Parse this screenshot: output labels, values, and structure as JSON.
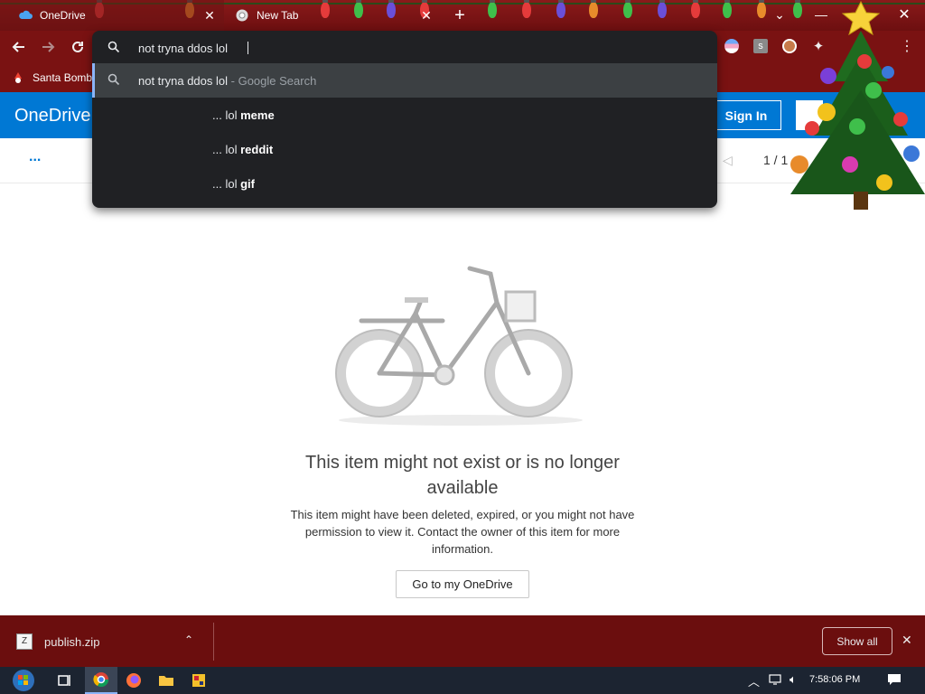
{
  "browser": {
    "tabs": [
      {
        "label": "OneDrive",
        "active": true
      },
      {
        "label": "New Tab",
        "active": false
      }
    ],
    "new_tab_symbol": "+",
    "bookmark_label": "Santa Bomb"
  },
  "omnibox": {
    "query": "not tryna ddos lol",
    "suggestions": [
      {
        "text": "not tryna ddos lol",
        "suffix": "- Google Search",
        "selected": true
      },
      {
        "prefix": "... lol",
        "bold": "meme"
      },
      {
        "prefix": "... lol",
        "bold": "reddit"
      },
      {
        "prefix": "... lol",
        "bold": "gif"
      }
    ]
  },
  "onedrive": {
    "title": "OneDrive",
    "sign_in": "Sign In",
    "more_symbol": "...",
    "pager": "1 / 1",
    "error_title": "This item might not exist or is no longer available",
    "error_body": "This item might have been deleted, expired, or you might not have permission to view it. Contact the owner of this item for more information.",
    "go_button": "Go to my OneDrive"
  },
  "downloads": {
    "file_name": "publish.zip",
    "show_all": "Show all"
  },
  "taskbar": {
    "time": "7:58:06 PM"
  },
  "colors": {
    "chrome_frame": "#7a1212",
    "onedrive_blue": "#0078d4",
    "omnibox_bg": "#202124",
    "taskbar": "#1c2431"
  }
}
